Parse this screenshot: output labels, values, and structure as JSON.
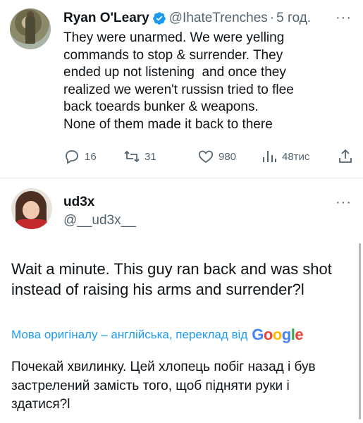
{
  "tweet": {
    "author_name": "Ryan O'Leary",
    "handle": "@IhateTrenches",
    "separator": "·",
    "time": "5 год.",
    "more": "···",
    "text_lines": [
      "They were unarmed. We were yelling",
      "commands to stop & surrender. They",
      "ended up not listening  and once they",
      "realized we weren't russisn tried to flee",
      "back toeards bunker & weapons.",
      "None of them made it back to there"
    ],
    "stats": {
      "replies": "16",
      "retweets": "31",
      "likes": "980",
      "views": "48тис"
    },
    "icons": {
      "verified": "verified-badge-icon",
      "reply": "reply-icon",
      "retweet": "retweet-icon",
      "like": "heart-icon",
      "views": "views-chart-icon",
      "share": "share-icon"
    }
  },
  "reply": {
    "author_name": "ud3x",
    "handle": "@__ud3x__",
    "more": "···",
    "text_lines": [
      "Wait a minute. This guy ran back and was shot",
      "instead of raising his arms and surrender?l"
    ],
    "translation_notice": "Мова оригіналу – англійська, переклад від",
    "translation_brand": [
      "G",
      "o",
      "o",
      "g",
      "l",
      "e"
    ],
    "translated_lines": [
      "Почекай хвилинку. Цей хлопець побіг назад і був",
      "застрелений замість того, щоб підняти руки і",
      "здатися?l"
    ]
  },
  "colors": {
    "accent": "#1d9bf0",
    "text": "#0f1419",
    "secondary": "#536471"
  }
}
